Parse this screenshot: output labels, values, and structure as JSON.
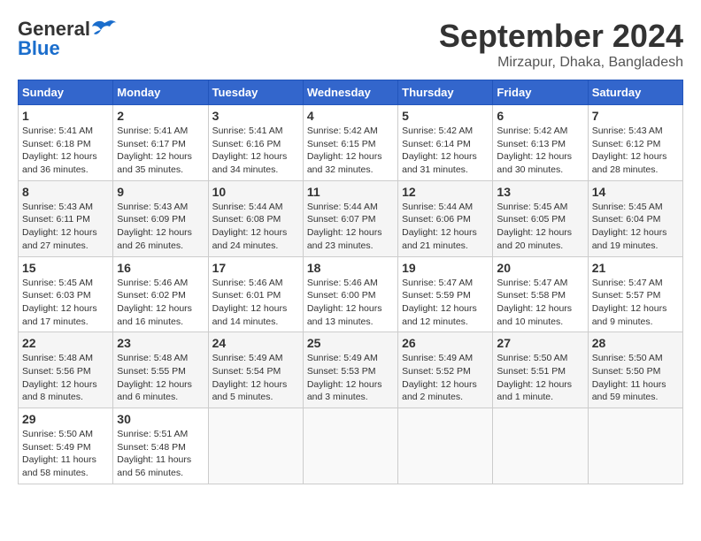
{
  "header": {
    "logo_general": "General",
    "logo_blue": "Blue",
    "month_title": "September 2024",
    "location": "Mirzapur, Dhaka, Bangladesh"
  },
  "weekdays": [
    "Sunday",
    "Monday",
    "Tuesday",
    "Wednesday",
    "Thursday",
    "Friday",
    "Saturday"
  ],
  "weeks": [
    [
      {
        "day": "1",
        "info": "Sunrise: 5:41 AM\nSunset: 6:18 PM\nDaylight: 12 hours\nand 36 minutes."
      },
      {
        "day": "2",
        "info": "Sunrise: 5:41 AM\nSunset: 6:17 PM\nDaylight: 12 hours\nand 35 minutes."
      },
      {
        "day": "3",
        "info": "Sunrise: 5:41 AM\nSunset: 6:16 PM\nDaylight: 12 hours\nand 34 minutes."
      },
      {
        "day": "4",
        "info": "Sunrise: 5:42 AM\nSunset: 6:15 PM\nDaylight: 12 hours\nand 32 minutes."
      },
      {
        "day": "5",
        "info": "Sunrise: 5:42 AM\nSunset: 6:14 PM\nDaylight: 12 hours\nand 31 minutes."
      },
      {
        "day": "6",
        "info": "Sunrise: 5:42 AM\nSunset: 6:13 PM\nDaylight: 12 hours\nand 30 minutes."
      },
      {
        "day": "7",
        "info": "Sunrise: 5:43 AM\nSunset: 6:12 PM\nDaylight: 12 hours\nand 28 minutes."
      }
    ],
    [
      {
        "day": "8",
        "info": "Sunrise: 5:43 AM\nSunset: 6:11 PM\nDaylight: 12 hours\nand 27 minutes."
      },
      {
        "day": "9",
        "info": "Sunrise: 5:43 AM\nSunset: 6:09 PM\nDaylight: 12 hours\nand 26 minutes."
      },
      {
        "day": "10",
        "info": "Sunrise: 5:44 AM\nSunset: 6:08 PM\nDaylight: 12 hours\nand 24 minutes."
      },
      {
        "day": "11",
        "info": "Sunrise: 5:44 AM\nSunset: 6:07 PM\nDaylight: 12 hours\nand 23 minutes."
      },
      {
        "day": "12",
        "info": "Sunrise: 5:44 AM\nSunset: 6:06 PM\nDaylight: 12 hours\nand 21 minutes."
      },
      {
        "day": "13",
        "info": "Sunrise: 5:45 AM\nSunset: 6:05 PM\nDaylight: 12 hours\nand 20 minutes."
      },
      {
        "day": "14",
        "info": "Sunrise: 5:45 AM\nSunset: 6:04 PM\nDaylight: 12 hours\nand 19 minutes."
      }
    ],
    [
      {
        "day": "15",
        "info": "Sunrise: 5:45 AM\nSunset: 6:03 PM\nDaylight: 12 hours\nand 17 minutes."
      },
      {
        "day": "16",
        "info": "Sunrise: 5:46 AM\nSunset: 6:02 PM\nDaylight: 12 hours\nand 16 minutes."
      },
      {
        "day": "17",
        "info": "Sunrise: 5:46 AM\nSunset: 6:01 PM\nDaylight: 12 hours\nand 14 minutes."
      },
      {
        "day": "18",
        "info": "Sunrise: 5:46 AM\nSunset: 6:00 PM\nDaylight: 12 hours\nand 13 minutes."
      },
      {
        "day": "19",
        "info": "Sunrise: 5:47 AM\nSunset: 5:59 PM\nDaylight: 12 hours\nand 12 minutes."
      },
      {
        "day": "20",
        "info": "Sunrise: 5:47 AM\nSunset: 5:58 PM\nDaylight: 12 hours\nand 10 minutes."
      },
      {
        "day": "21",
        "info": "Sunrise: 5:47 AM\nSunset: 5:57 PM\nDaylight: 12 hours\nand 9 minutes."
      }
    ],
    [
      {
        "day": "22",
        "info": "Sunrise: 5:48 AM\nSunset: 5:56 PM\nDaylight: 12 hours\nand 8 minutes."
      },
      {
        "day": "23",
        "info": "Sunrise: 5:48 AM\nSunset: 5:55 PM\nDaylight: 12 hours\nand 6 minutes."
      },
      {
        "day": "24",
        "info": "Sunrise: 5:49 AM\nSunset: 5:54 PM\nDaylight: 12 hours\nand 5 minutes."
      },
      {
        "day": "25",
        "info": "Sunrise: 5:49 AM\nSunset: 5:53 PM\nDaylight: 12 hours\nand 3 minutes."
      },
      {
        "day": "26",
        "info": "Sunrise: 5:49 AM\nSunset: 5:52 PM\nDaylight: 12 hours\nand 2 minutes."
      },
      {
        "day": "27",
        "info": "Sunrise: 5:50 AM\nSunset: 5:51 PM\nDaylight: 12 hours\nand 1 minute."
      },
      {
        "day": "28",
        "info": "Sunrise: 5:50 AM\nSunset: 5:50 PM\nDaylight: 11 hours\nand 59 minutes."
      }
    ],
    [
      {
        "day": "29",
        "info": "Sunrise: 5:50 AM\nSunset: 5:49 PM\nDaylight: 11 hours\nand 58 minutes."
      },
      {
        "day": "30",
        "info": "Sunrise: 5:51 AM\nSunset: 5:48 PM\nDaylight: 11 hours\nand 56 minutes."
      },
      null,
      null,
      null,
      null,
      null
    ]
  ]
}
